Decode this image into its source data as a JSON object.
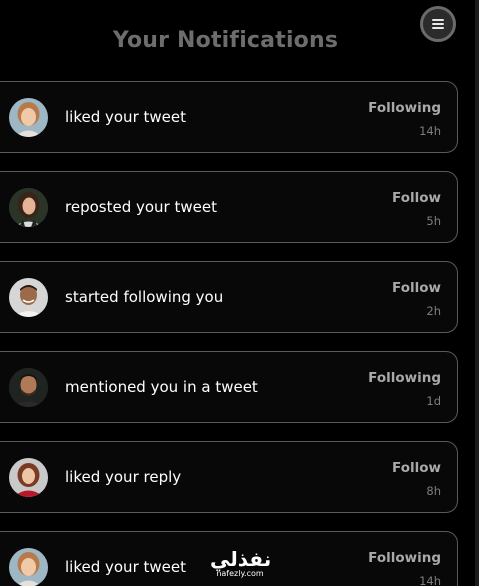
{
  "header": {
    "title": "Your Notifications"
  },
  "menu": {
    "icon": "hamburger-menu-icon"
  },
  "notifications": [
    {
      "text": "liked your tweet",
      "action": "Following",
      "time": "14h",
      "avatar": "woman-blonde"
    },
    {
      "text": "reposted your tweet",
      "action": "Follow",
      "time": "5h",
      "avatar": "woman-dark-hair"
    },
    {
      "text": "started following you",
      "action": "Follow",
      "time": "2h",
      "avatar": "man-smiling"
    },
    {
      "text": "mentioned you in a tweet",
      "action": "Following",
      "time": "1d",
      "avatar": "man-dark"
    },
    {
      "text": "liked your reply",
      "action": "Follow",
      "time": "8h",
      "avatar": "woman-red-hair"
    },
    {
      "text": "liked your tweet",
      "action": "Following",
      "time": "14h",
      "avatar": "woman-blonde"
    }
  ],
  "watermark": {
    "arabic": "نفذلي",
    "latin": "nafezly.com"
  },
  "colors": {
    "background": "#000000",
    "card_border": "#5a5a5a",
    "title": "#6d6d6d",
    "action": "#a9a9a9",
    "time": "#7e7e7e"
  }
}
